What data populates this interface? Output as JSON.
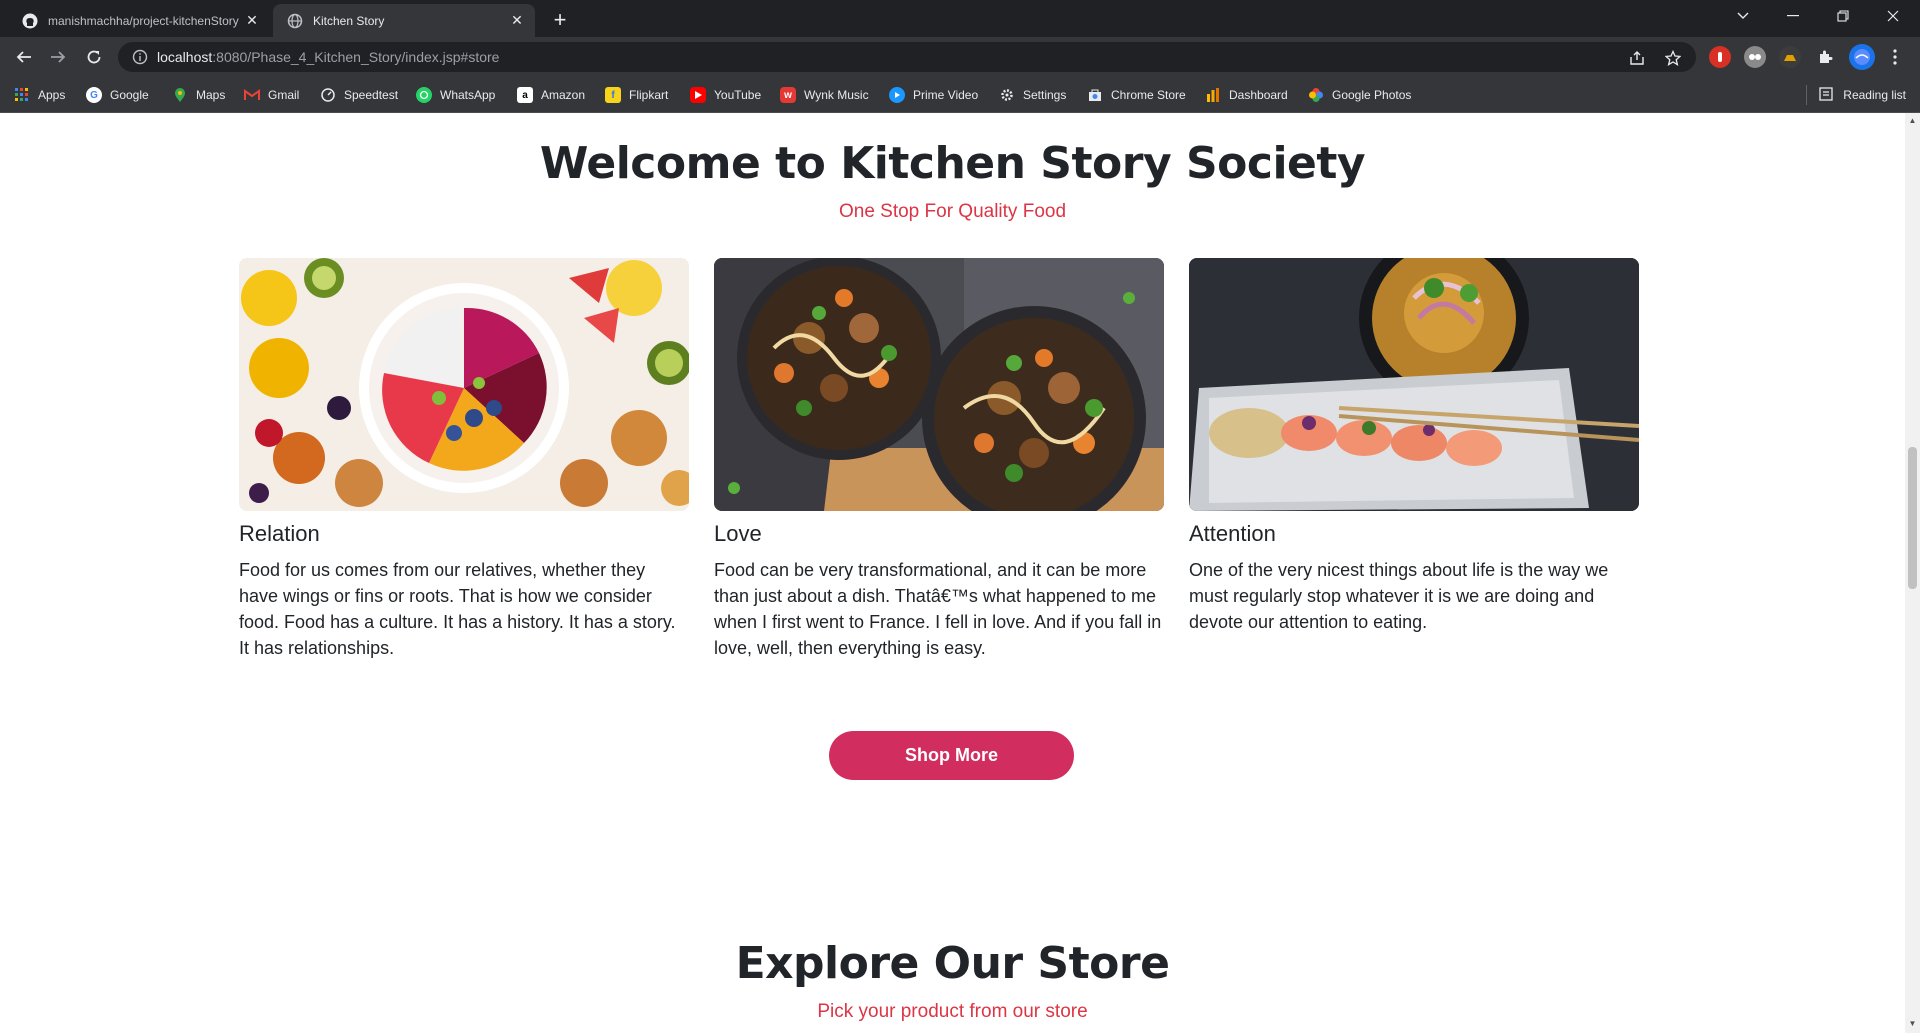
{
  "browser": {
    "tabs": [
      {
        "title": "manishmachha/project-kitchenStory",
        "active": false,
        "icon": "github-icon"
      },
      {
        "title": "Kitchen Story",
        "active": true,
        "icon": "globe-icon"
      }
    ],
    "url_host": "localhost",
    "url_rest": ":8080/Phase_4_Kitchen_Story/index.jsp#store",
    "bookmarks": [
      {
        "label": "Apps",
        "icon": "apps-grid-icon",
        "color": "#4285f4"
      },
      {
        "label": "Google",
        "icon": "google-icon",
        "color": "#ffffff"
      },
      {
        "label": "Maps",
        "icon": "maps-icon",
        "color": "#34a853"
      },
      {
        "label": "Gmail",
        "icon": "gmail-icon",
        "color": "#ea4335"
      },
      {
        "label": "Speedtest",
        "icon": "speedtest-icon",
        "color": "#e8eaed"
      },
      {
        "label": "WhatsApp",
        "icon": "whatsapp-icon",
        "color": "#25d366"
      },
      {
        "label": "Amazon",
        "icon": "amazon-icon",
        "color": "#ffffff"
      },
      {
        "label": "Flipkart",
        "icon": "flipkart-icon",
        "color": "#f8d21b"
      },
      {
        "label": "YouTube",
        "icon": "youtube-icon",
        "color": "#ff0000"
      },
      {
        "label": "Wynk Music",
        "icon": "wynk-icon",
        "color": "#e53935"
      },
      {
        "label": "Prime Video",
        "icon": "prime-video-icon",
        "color": "#1a98ff"
      },
      {
        "label": "Settings",
        "icon": "gear-icon",
        "color": "#e8eaed"
      },
      {
        "label": "Chrome Store",
        "icon": "chrome-store-icon",
        "color": "#ea4335"
      },
      {
        "label": "Dashboard",
        "icon": "dashboard-icon",
        "color": "#fbbc04"
      },
      {
        "label": "Google Photos",
        "icon": "google-photos-icon",
        "color": "#fbbc04"
      }
    ],
    "reading_list": "Reading list"
  },
  "hero": {
    "title": "Welcome to Kitchen Story Society",
    "subtitle": "One Stop For Quality Food"
  },
  "cards": [
    {
      "title": "Relation",
      "text": "Food for us comes from our relatives, whether they have wings or fins or roots. That is how we consider food. Food has a culture. It has a history. It has a story. It has relationships.",
      "image": "fruit-bowl-photo"
    },
    {
      "title": "Love",
      "text": "Food can be very transformational, and it can be more than just about a dish. Thatâ€™s what happened to me when I first went to France. I fell in love. And if you fall in love, well, then everything is easy.",
      "image": "noodle-bowls-photo"
    },
    {
      "title": "Attention",
      "text": "One of the very nicest things about life is the way we must regularly stop whatever it is we are doing and devote our attention to eating.",
      "image": "salmon-plate-photo"
    }
  ],
  "shop_button": "Shop More",
  "store": {
    "title": "Explore Our Store",
    "subtitle": "Pick your product from our store"
  },
  "colors": {
    "accent_red": "#dc3545",
    "button_pink": "#d12d5e",
    "text_dark": "#212529"
  }
}
